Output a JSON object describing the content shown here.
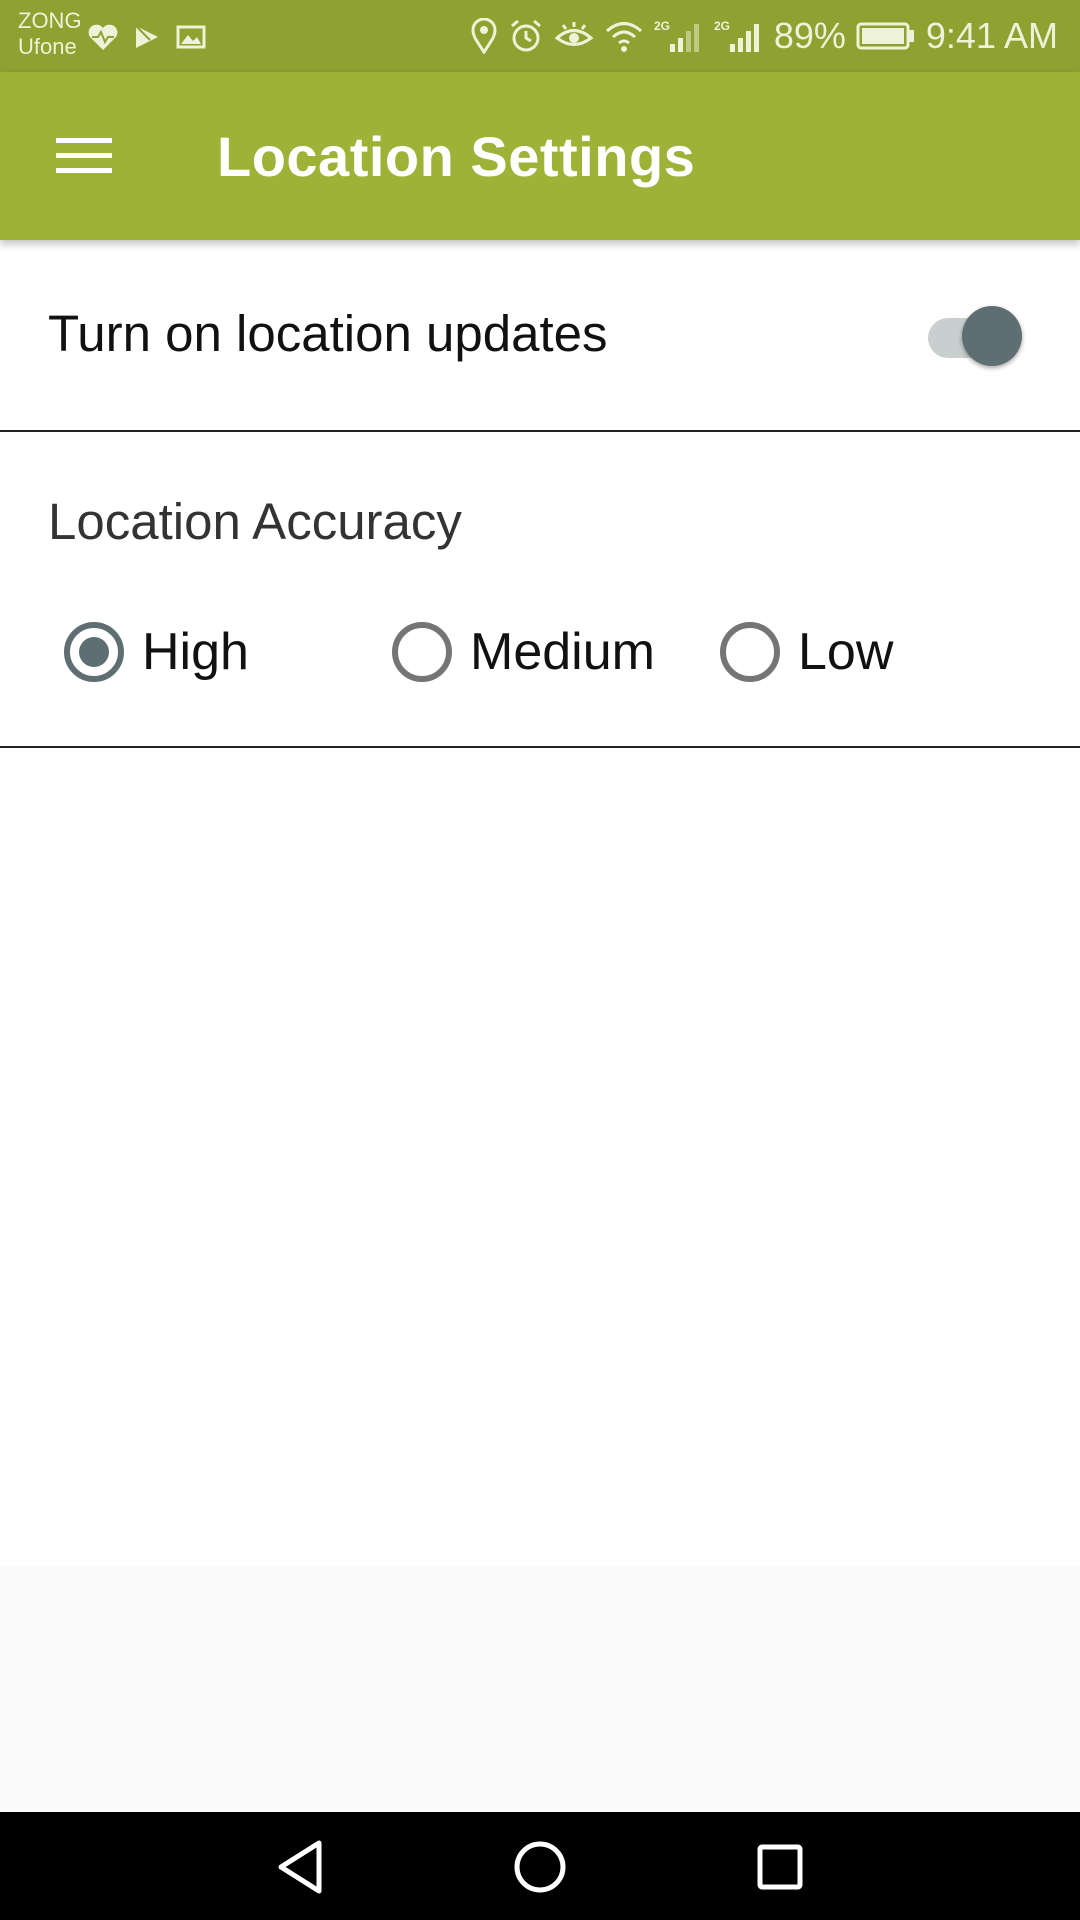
{
  "status_bar": {
    "carrier_1": "ZONG",
    "carrier_2": "Ufone",
    "battery": "89%",
    "time": "9:41 AM",
    "network_1": "2G",
    "network_2": "2G"
  },
  "app_bar": {
    "title": "Location Settings",
    "color": "#9db236"
  },
  "location_updates": {
    "label": "Turn on location updates",
    "enabled": true
  },
  "accuracy": {
    "title": "Location Accuracy",
    "options": [
      {
        "label": "High",
        "selected": true
      },
      {
        "label": "Medium",
        "selected": false
      },
      {
        "label": "Low",
        "selected": false
      }
    ]
  },
  "icons": {
    "menu": "hamburger-menu-icon",
    "back": "back-triangle-icon",
    "home": "home-circle-icon",
    "recents": "recents-square-icon"
  }
}
